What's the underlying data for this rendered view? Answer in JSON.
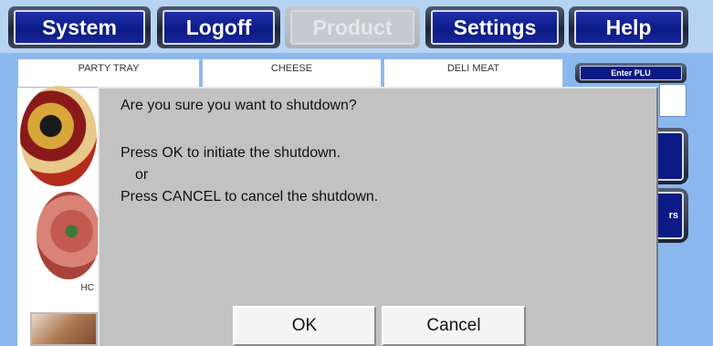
{
  "nav": {
    "items": [
      {
        "label": "System",
        "enabled": true
      },
      {
        "label": "Logoff",
        "enabled": true
      },
      {
        "label": "Product",
        "enabled": false
      },
      {
        "label": "Settings",
        "enabled": true
      },
      {
        "label": "Help",
        "enabled": true
      }
    ]
  },
  "categories": [
    "PARTY TRAY",
    "CHEESE",
    "DELI MEAT"
  ],
  "tiles": {
    "partial_label": "HC"
  },
  "side": {
    "enter_plu_label": "Enter PLU",
    "partial_button_label": "rs"
  },
  "dialog": {
    "title": "Are you sure you want to shutdown?",
    "line1": "Press OK to initiate the shutdown.",
    "line2": "or",
    "line3": "Press CANCEL to cancel the shutdown.",
    "ok_label": "OK",
    "cancel_label": "Cancel"
  }
}
